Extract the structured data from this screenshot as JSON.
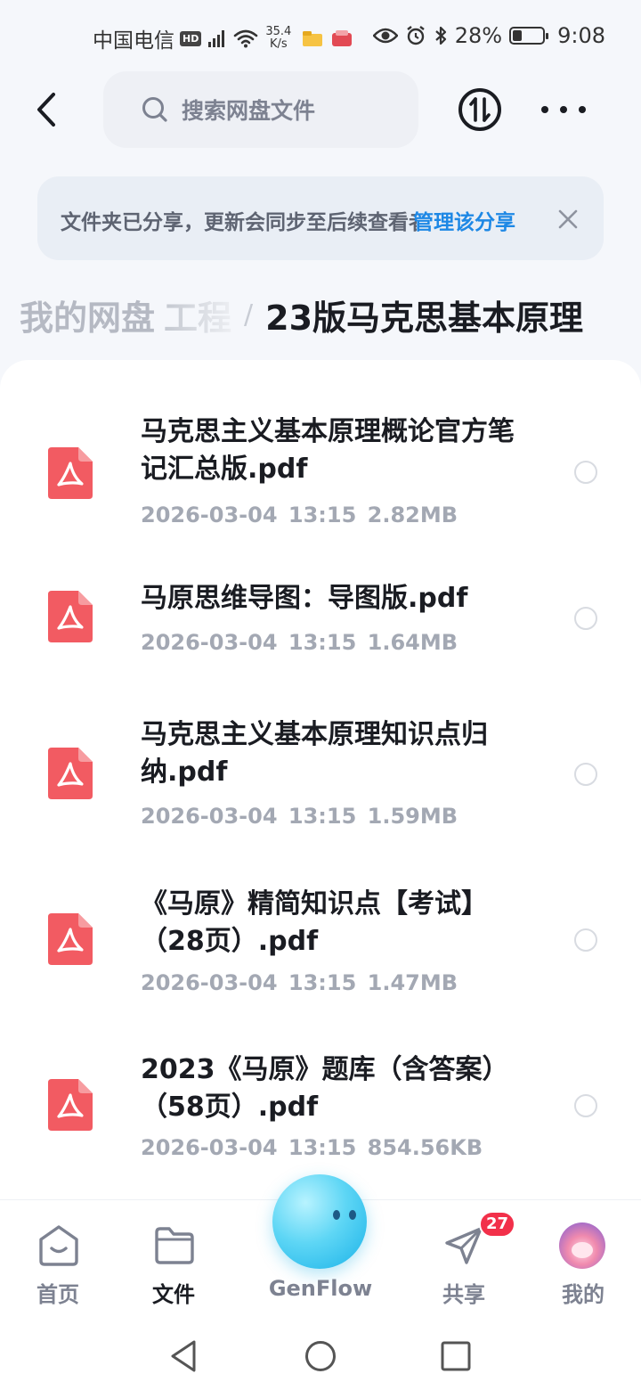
{
  "status_bar": {
    "carrier": "中国电信",
    "hd": "HD",
    "net_type": "4G",
    "speed_value": "35.4",
    "speed_unit": "K/s",
    "battery": "28%",
    "battery_level": 0.28,
    "time": "9:08"
  },
  "search": {
    "placeholder": "搜索网盘文件"
  },
  "banner": {
    "text": "文件夹已分享，更新会同步至后续查看者",
    "link": "管理该分享"
  },
  "breadcrumb": {
    "root": "我的网盘",
    "parent": "工程",
    "separator": "/",
    "current": "23版马克思基本原理"
  },
  "files": [
    {
      "name": "马克思主义基本原理概论官方笔记汇总版.pdf",
      "date": "2026-03-04",
      "time": "13:15",
      "size": "2.82MB"
    },
    {
      "name": "马原思维导图：导图版.pdf",
      "date": "2026-03-04",
      "time": "13:15",
      "size": "1.64MB"
    },
    {
      "name": "马克思主义基本原理知识点归纳.pdf",
      "date": "2026-03-04",
      "time": "13:15",
      "size": "1.59MB"
    },
    {
      "name": "《马原》精简知识点【考试】（28页）.pdf",
      "date": "2026-03-04",
      "time": "13:15",
      "size": "1.47MB"
    },
    {
      "name": "2023《马原》题库（含答案）（58页）.pdf",
      "date": "2026-03-04",
      "time": "13:15",
      "size": "854.56KB"
    }
  ],
  "bottom_nav": {
    "home": "首页",
    "files": "文件",
    "genflow": "GenFlow",
    "share": "共享",
    "share_badge": "27",
    "me": "我的"
  },
  "colors": {
    "accent": "#1e88e5",
    "pdf": "#f25b62",
    "badge": "#f2304a"
  }
}
